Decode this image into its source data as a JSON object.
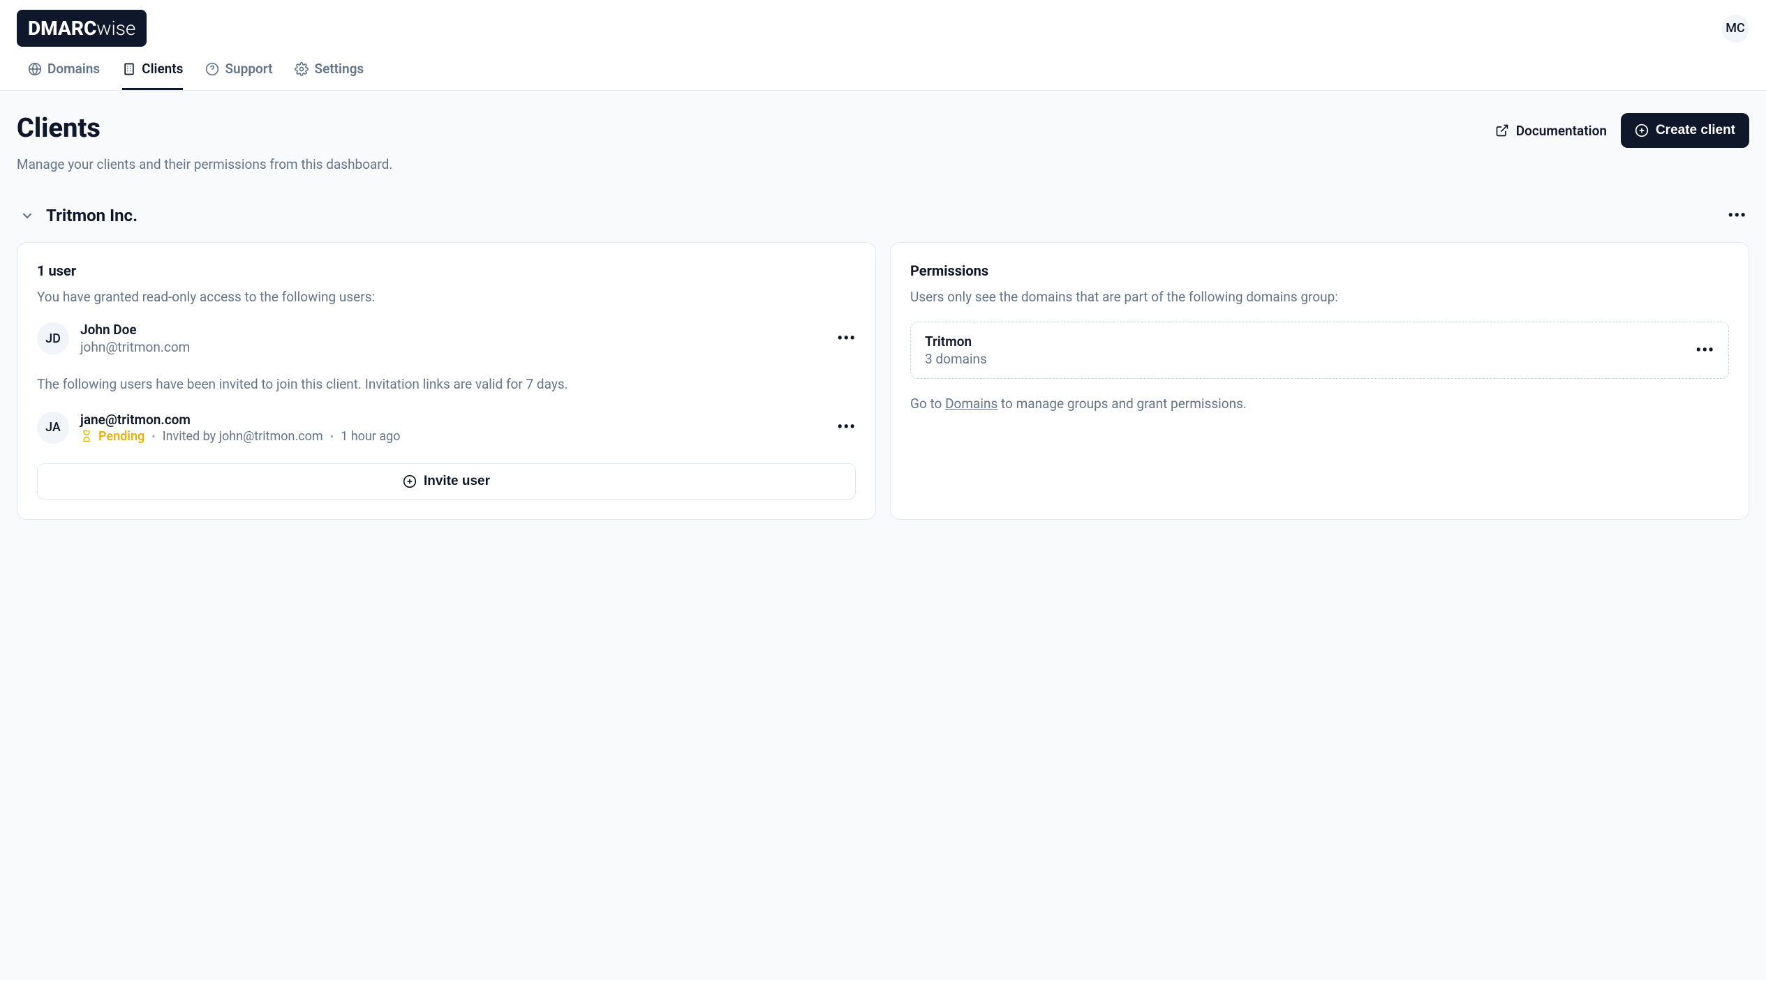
{
  "header": {
    "logo_bold": "DMARC",
    "logo_light": "wise",
    "avatar_initials": "MC"
  },
  "nav": {
    "tabs": [
      {
        "label": "Domains"
      },
      {
        "label": "Clients"
      },
      {
        "label": "Support"
      },
      {
        "label": "Settings"
      }
    ],
    "active_index": 1
  },
  "page": {
    "title": "Clients",
    "subtitle": "Manage your clients and their permissions from this dashboard.",
    "doc_label": "Documentation",
    "create_label": "Create client"
  },
  "client": {
    "name": "Tritmon Inc.",
    "users_card": {
      "title": "1 user",
      "subtitle": "You have granted read-only access to the following users:",
      "user": {
        "initials": "JD",
        "name": "John Doe",
        "email": "john@tritmon.com"
      },
      "invite_text": "The following users have been invited to join this client. Invitation links are valid for 7 days.",
      "pending": {
        "initials": "JA",
        "email": "jane@tritmon.com",
        "status": "Pending",
        "invited_by": "Invited by john@tritmon.com",
        "time": "1 hour ago"
      },
      "invite_button": "Invite user"
    },
    "permissions_card": {
      "title": "Permissions",
      "subtitle": "Users only see the domains that are part of the following domains group:",
      "group": {
        "name": "Tritmon",
        "count": "3 domains"
      },
      "footer_prefix": "Go to ",
      "footer_link": "Domains",
      "footer_suffix": " to manage groups and grant permissions."
    }
  }
}
